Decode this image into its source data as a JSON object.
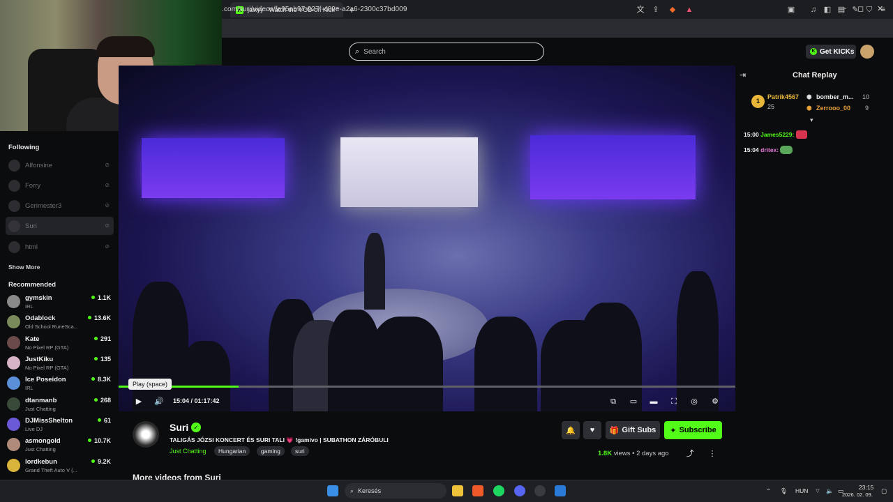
{
  "browser": {
    "tab_title": "jaixyy - Watch the VOD on Kick",
    "tab_close": "×",
    "new_tab": "+",
    "url": ".com/suri/videos/fa95ab97-927f-409e-a2a6-2300c37bd009",
    "window_controls": [
      "—",
      "◻",
      "✕"
    ]
  },
  "header": {
    "search_placeholder": "Search",
    "get_kicks_label": "Get KICKs"
  },
  "sidebar": {
    "following_title": "Following",
    "following": [
      {
        "name": "Alfonsine"
      },
      {
        "name": "Forry"
      },
      {
        "name": "Gerimester3"
      },
      {
        "name": "Suri"
      },
      {
        "name": "html"
      }
    ],
    "show_more": "Show More",
    "recommended_title": "Recommended",
    "recommended": [
      {
        "name": "gymskin",
        "category": "IRL",
        "viewers": "1.1K"
      },
      {
        "name": "Odablock",
        "category": "Old School RuneSca...",
        "viewers": "13.6K"
      },
      {
        "name": "Kate",
        "category": "No Pixel RP (GTA)",
        "viewers": "291"
      },
      {
        "name": "JustKiku",
        "category": "No Pixel RP (GTA)",
        "viewers": "135"
      },
      {
        "name": "Ice Poseidon",
        "category": "IRL",
        "viewers": "8.3K"
      },
      {
        "name": "dtanmanb",
        "category": "Just Chatting",
        "viewers": "268"
      },
      {
        "name": "DJMissShelton",
        "category": "Live DJ",
        "viewers": "61"
      },
      {
        "name": "asmongold",
        "category": "Just Chatting",
        "viewers": "10.7K"
      },
      {
        "name": "lordkebun",
        "category": "Grand Theft Auto V (...",
        "viewers": "9.2K"
      }
    ]
  },
  "player": {
    "progress": 0.195,
    "tooltip": "Play (space)",
    "timecode": "15:04 / 01:17:42"
  },
  "channel": {
    "name": "Suri",
    "title": "TALIGÁS JÓZSI KONCERT ÉS SURI TALI 💗 !gamivo | SUBATHON ZÁRÓBULI",
    "category": "Just Chatting",
    "tags": [
      "Hungarian",
      "gaming",
      "suri"
    ],
    "gift_subs": "Gift Subs",
    "subscribe": "Subscribe",
    "views_count": "1.8K",
    "views_suffix": "views",
    "age": "2 days ago",
    "more_videos": "More videos from Suri"
  },
  "chat": {
    "title": "Chat Replay",
    "leaderboard": [
      {
        "rank": "1",
        "name": "Patrik4567",
        "count": "25"
      },
      {
        "name": "bomber_m...",
        "count": "10"
      },
      {
        "name": "Zerrooo_00",
        "count": "9"
      }
    ],
    "messages": [
      {
        "time": "15:00",
        "user": "James5229:"
      },
      {
        "time": "15:04",
        "user": "dritex:"
      }
    ]
  },
  "taskbar": {
    "search_label": "Keresés",
    "lang": "HUN",
    "time": "23:15",
    "date": "2026. 02. 09."
  },
  "colors": {
    "kick_green": "#53fc18",
    "background": "#0b0c0e"
  }
}
